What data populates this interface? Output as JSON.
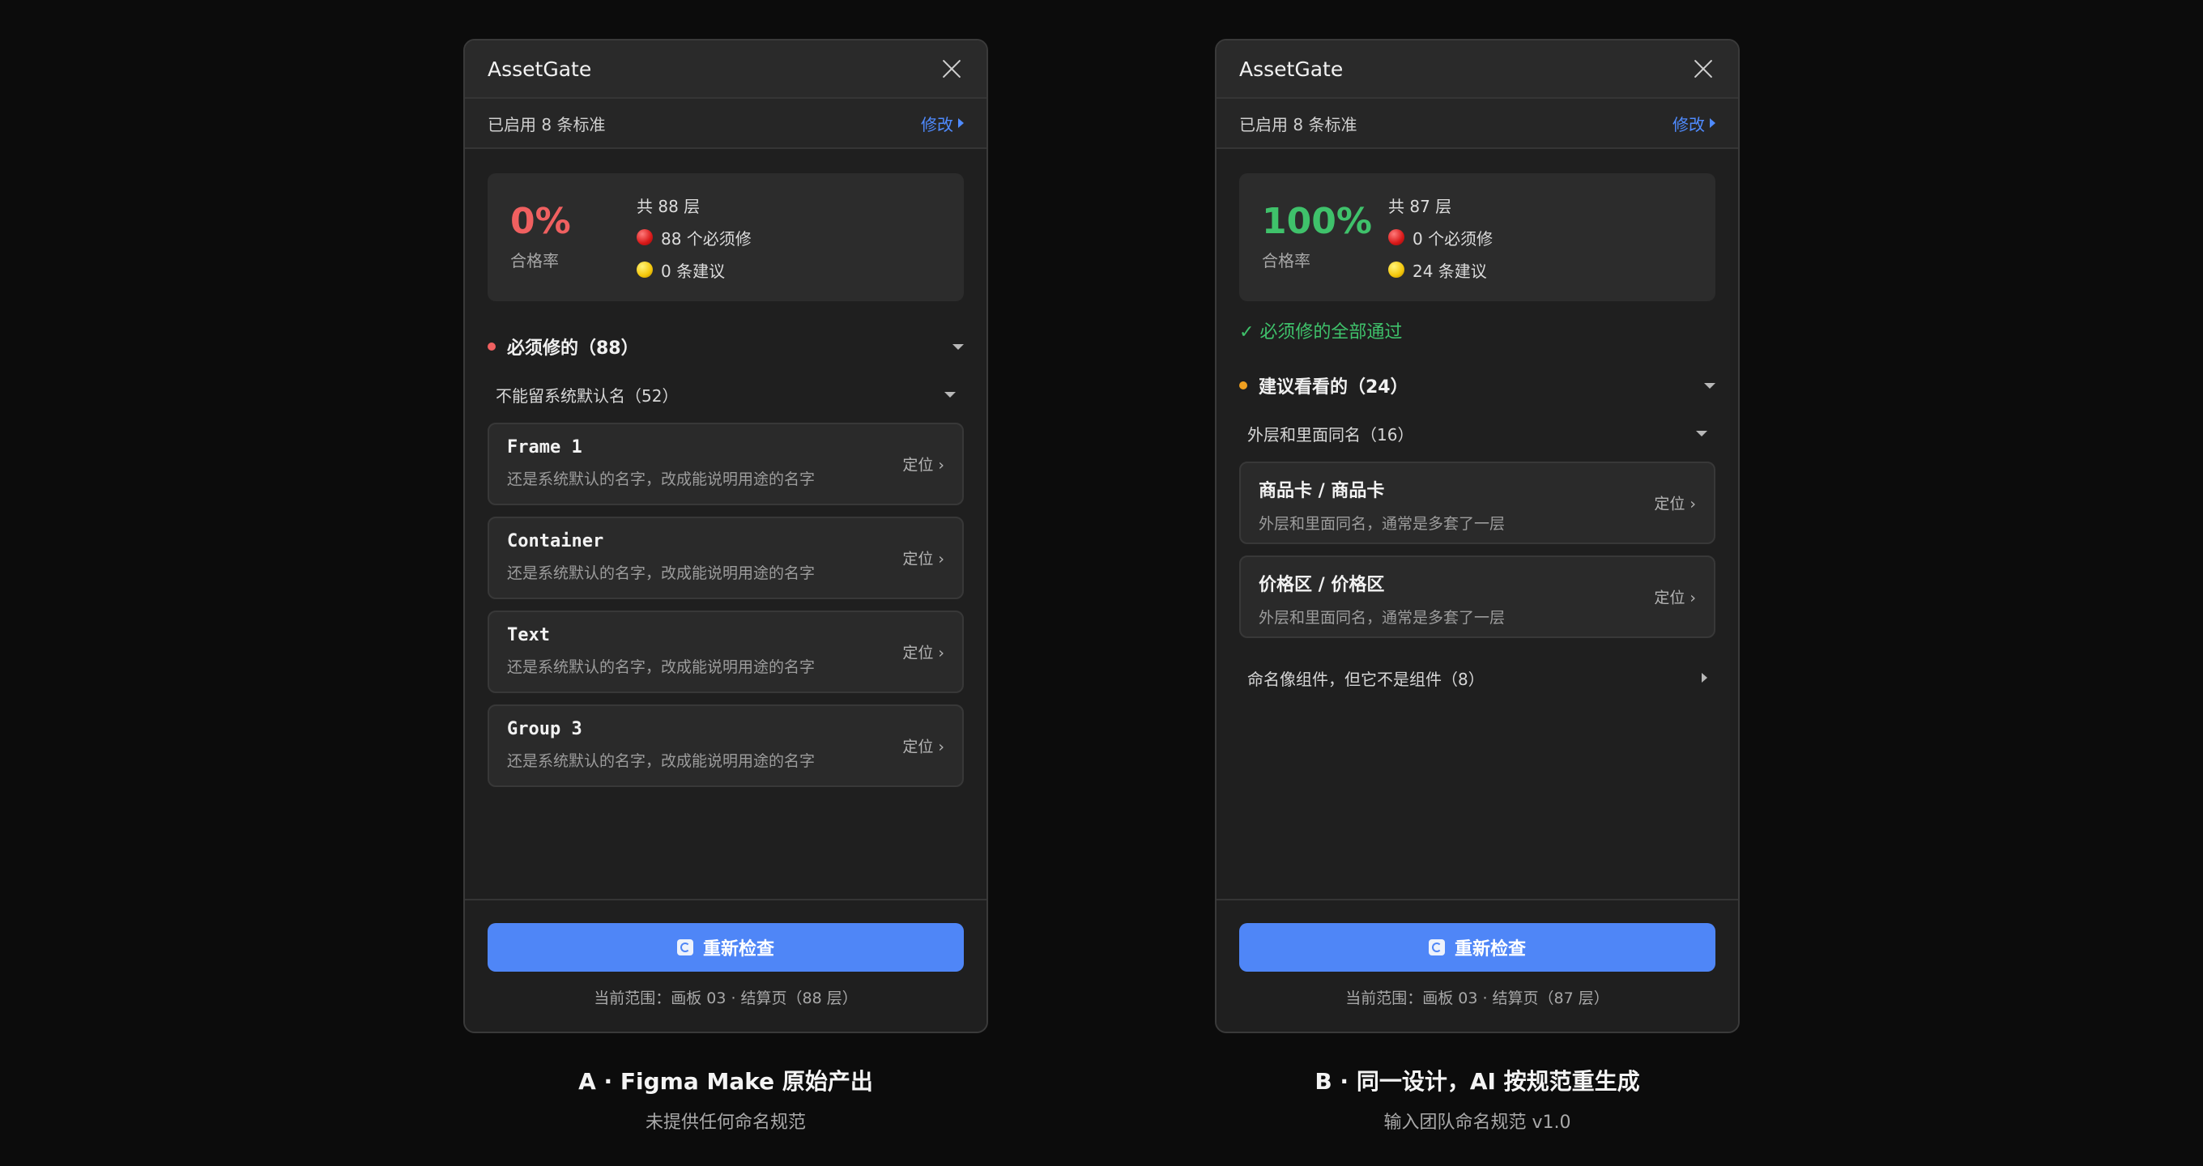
{
  "colors": {
    "background": "#0c0c0c",
    "accent": "#4f86f7",
    "fail": "#f06060",
    "pass": "#3fc26b",
    "warn": "#f0a020"
  },
  "panel_a": {
    "title": "AssetGate",
    "standards_text": "已启用 8 条标准",
    "edit_label": "修改",
    "rate_value": "0%",
    "rate_label": "合格率",
    "total_layers": "共 88 层",
    "must_fix_count": "88 个必须修",
    "suggestion_count": "0 条建议",
    "section": {
      "title": "必须修的（88）"
    },
    "group": {
      "title": "不能留系统默认名（52）"
    },
    "items": [
      {
        "name": "Frame 1",
        "desc": "还是系统默认的名字，改成能说明用途的名字",
        "action": "定位 ›"
      },
      {
        "name": "Container",
        "desc": "还是系统默认的名字，改成能说明用途的名字",
        "action": "定位 ›"
      },
      {
        "name": "Text",
        "desc": "还是系统默认的名字，改成能说明用途的名字",
        "action": "定位 ›"
      },
      {
        "name": "Group 3",
        "desc": "还是系统默认的名字，改成能说明用途的名字",
        "action": "定位 ›"
      }
    ],
    "recheck_label": "重新检查",
    "scope_text": "当前范围：画板 03 · 结算页（88 层）"
  },
  "panel_b": {
    "title": "AssetGate",
    "standards_text": "已启用 8 条标准",
    "edit_label": "修改",
    "rate_value": "100%",
    "rate_label": "合格率",
    "total_layers": "共 87 层",
    "must_fix_count": "0 个必须修",
    "suggestion_count": "24 条建议",
    "pass_note": "✓ 必须修的全部通过",
    "section": {
      "title": "建议看看的（24）"
    },
    "group": {
      "title": "外层和里面同名（16）"
    },
    "items": [
      {
        "name": "商品卡 / 商品卡",
        "desc": "外层和里面同名，通常是多套了一层",
        "action": "定位 ›"
      },
      {
        "name": "价格区 / 价格区",
        "desc": "外层和里面同名，通常是多套了一层",
        "action": "定位 ›"
      }
    ],
    "group2": {
      "title": "命名像组件，但它不是组件（8）"
    },
    "recheck_label": "重新检查",
    "scope_text": "当前范围：画板 03 · 结算页（87 层）"
  },
  "captions": {
    "a_title": "A · Figma Make 原始产出",
    "a_sub": "未提供任何命名规范",
    "b_title": "B · 同一设计，AI 按规范重生成",
    "b_sub": "输入团队命名规范 v1.0"
  }
}
